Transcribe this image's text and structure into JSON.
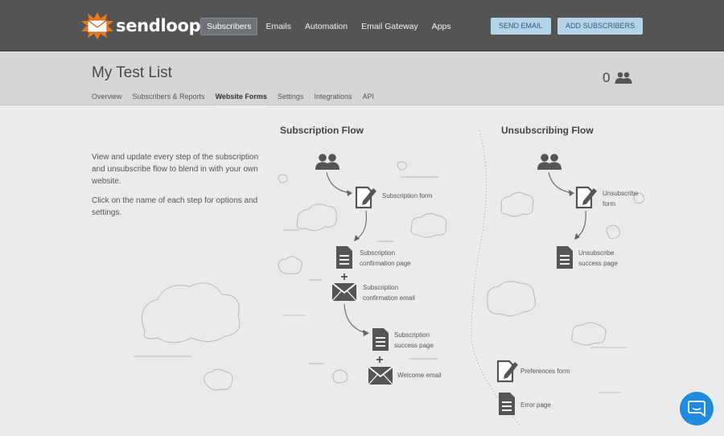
{
  "app": {
    "brand": "sendloop",
    "accent": "#b5d4ea",
    "chat_color": "#1f8bde"
  },
  "nav": {
    "items": [
      {
        "label": "Subscribers",
        "active": true
      },
      {
        "label": "Emails",
        "active": false
      },
      {
        "label": "Automation",
        "active": false
      },
      {
        "label": "Email Gateway",
        "active": false
      },
      {
        "label": "Apps",
        "active": false
      }
    ],
    "send_email": "SEND EMAIL",
    "add_subscribers": "ADD SUBSCRIBERS"
  },
  "list": {
    "title": "My Test List",
    "subscriber_count": "0",
    "tabs": [
      {
        "label": "Overview",
        "active": false
      },
      {
        "label": "Subscribers & Reports",
        "active": false
      },
      {
        "label": "Website Forms",
        "active": true
      },
      {
        "label": "Settings",
        "active": false
      },
      {
        "label": "Integrations",
        "active": false
      },
      {
        "label": "API",
        "active": false
      }
    ]
  },
  "intro": {
    "paragraph1": "View and update every step of the subscription and unsubscribe flow to blend in with your own website.",
    "paragraph2": "Click on the name of each step for options and settings."
  },
  "subscription_flow": {
    "title": "Subscription Flow",
    "steps": {
      "form": [
        "Subscription form"
      ],
      "confirmation_page": [
        "Subscription",
        "confirmation page"
      ],
      "confirmation_email": [
        "Subscription",
        "confirmation email"
      ],
      "success_page": [
        "Subscription",
        "success page"
      ],
      "welcome_email": [
        "Welcome email"
      ]
    }
  },
  "unsubscribing_flow": {
    "title": "Unsubscribing Flow",
    "steps": {
      "form": [
        "Unsubscribe",
        "form"
      ],
      "success_page": [
        "Unsubscribe",
        "success page"
      ],
      "preferences_form": [
        "Preferences form"
      ],
      "error_page": [
        "Error page"
      ]
    }
  },
  "icons": {
    "logo": "sendloop-envelope-logo",
    "subscribers": "people-icon",
    "form": "edit-form-icon",
    "page": "document-icon",
    "email": "envelope-icon",
    "chat": "chat-icon"
  }
}
